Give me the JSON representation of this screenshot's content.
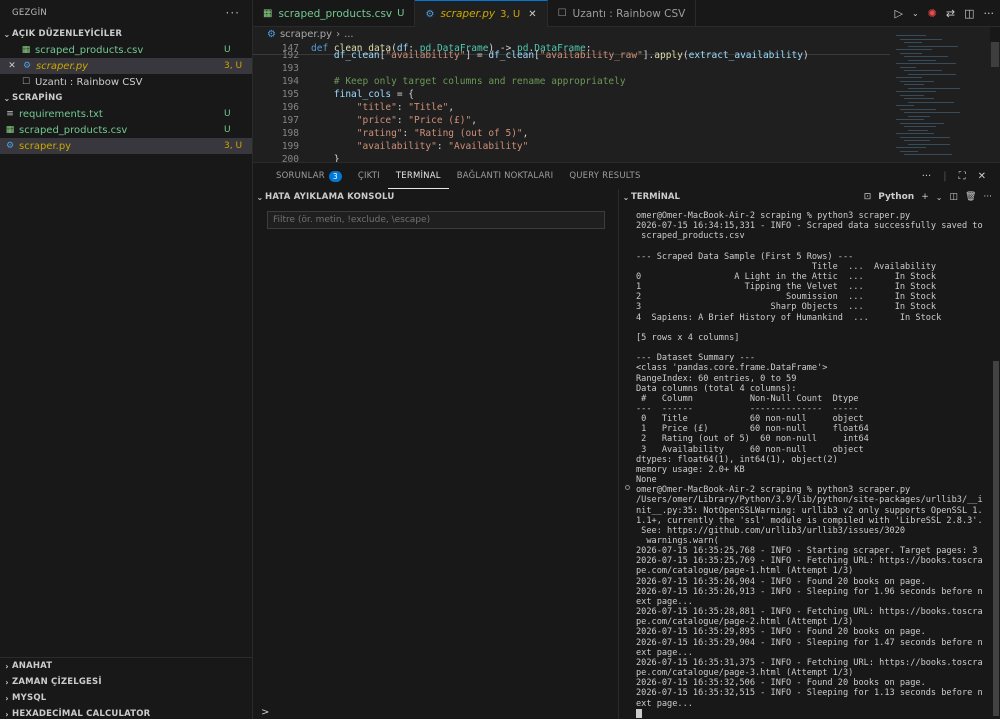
{
  "sidebar": {
    "title": "GEZGİN",
    "open_editors": {
      "label": "AÇIK DÜZENLEYİCİLER",
      "items": [
        {
          "name": "scraped_products.csv",
          "badge": "U"
        },
        {
          "name": "scraper.py",
          "badge": "3, U"
        },
        {
          "name": "Uzantı : Rainbow CSV",
          "badge": ""
        }
      ]
    },
    "folder": {
      "label": "SCRAPİNG",
      "items": [
        {
          "name": "requirements.txt",
          "badge": "U"
        },
        {
          "name": "scraped_products.csv",
          "badge": "U"
        },
        {
          "name": "scraper.py",
          "badge": "3, U"
        }
      ]
    },
    "bottom_sections": [
      "ANAHAT",
      "ZAMAN ÇİZELGESİ",
      "MYSQL",
      "HEXADECİMAL CALCULATOR"
    ]
  },
  "tabs": [
    {
      "label": "scraped_products.csv",
      "badge": "U"
    },
    {
      "label": "scraper.py",
      "badge": "3, U"
    },
    {
      "label": "Uzantı : Rainbow CSV",
      "badge": ""
    }
  ],
  "breadcrumb": {
    "file": "scraper.py",
    "rest": "..."
  },
  "editor": {
    "sticky_line": {
      "num": "147"
    },
    "lines": [
      {
        "num": "192"
      },
      {
        "num": "193"
      },
      {
        "num": "194"
      },
      {
        "num": "195"
      },
      {
        "num": "196"
      },
      {
        "num": "197"
      },
      {
        "num": "198"
      },
      {
        "num": "199"
      },
      {
        "num": "200"
      }
    ]
  },
  "panel": {
    "tabs": [
      {
        "label": "SORUNLAR",
        "badge": "3"
      },
      {
        "label": "ÇIKTI"
      },
      {
        "label": "TERMİNAL"
      },
      {
        "label": "BAĞLANTI NOKTALARI"
      },
      {
        "label": "QUERY RESULTS"
      }
    ],
    "debug": {
      "title": "HATA AYIKLAMA KONSOLU",
      "filter_placeholder": "Filtre (ör. metin, !exclude, \\escape)",
      "prompt": ">"
    },
    "terminal": {
      "title": "TERMİNAL",
      "shell": "Python",
      "lines": [
        "omer@Omer-MacBook-Air-2 scraping % python3 scraper.py",
        "2026-07-15 16:34:15,331 - INFO - Scraped data successfully saved to",
        " scraped_products.csv",
        "",
        "--- Scraped Data Sample (First 5 Rows) ---",
        "                                  Title  ...  Availability",
        "0                  A Light in the Attic  ...      In Stock",
        "1                    Tipping the Velvet  ...      In Stock",
        "2                            Soumission  ...      In Stock",
        "3                         Sharp Objects  ...      In Stock",
        "4  Sapiens: A Brief History of Humankind  ...      In Stock",
        "",
        "[5 rows x 4 columns]",
        "",
        "--- Dataset Summary ---",
        "<class 'pandas.core.frame.DataFrame'>",
        "RangeIndex: 60 entries, 0 to 59",
        "Data columns (total 4 columns):",
        " #   Column           Non-Null Count  Dtype",
        "---  ------           --------------  -----",
        " 0   Title            60 non-null     object",
        " 1   Price (£)        60 non-null     float64",
        " 2   Rating (out of 5)  60 non-null     int64",
        " 3   Availability     60 non-null     object",
        "dtypes: float64(1), int64(1), object(2)",
        "memory usage: 2.0+ KB",
        "None",
        "omer@Omer-MacBook-Air-2 scraping % python3 scraper.py",
        "/Users/omer/Library/Python/3.9/lib/python/site-packages/urllib3/__i",
        "nit__.py:35: NotOpenSSLWarning: urllib3 v2 only supports OpenSSL 1.",
        "1.1+, currently the 'ssl' module is compiled with 'LibreSSL 2.8.3'.",
        " See: https://github.com/urllib3/urllib3/issues/3020",
        "  warnings.warn(",
        "2026-07-15 16:35:25,768 - INFO - Starting scraper. Target pages: 3",
        "2026-07-15 16:35:25,769 - INFO - Fetching URL: https://books.toscra",
        "pe.com/catalogue/page-1.html (Attempt 1/3)",
        "2026-07-15 16:35:26,904 - INFO - Found 20 books on page.",
        "2026-07-15 16:35:26,913 - INFO - Sleeping for 1.96 seconds before n",
        "ext page...",
        "2026-07-15 16:35:28,881 - INFO - Fetching URL: https://books.toscra",
        "pe.com/catalogue/page-2.html (Attempt 1/3)",
        "2026-07-15 16:35:29,895 - INFO - Found 20 books on page.",
        "2026-07-15 16:35:29,904 - INFO - Sleeping for 1.47 seconds before n",
        "ext page...",
        "2026-07-15 16:35:31,375 - INFO - Fetching URL: https://books.toscra",
        "pe.com/catalogue/page-3.html (Attempt 1/3)",
        "2026-07-15 16:35:32,506 - INFO - Found 20 books on page.",
        "2026-07-15 16:35:32,515 - INFO - Sleeping for 1.13 seconds before n",
        "ext page..."
      ]
    }
  },
  "colors": {
    "accent": "#0078d4",
    "untracked": "#73c991",
    "modified": "#cca700"
  }
}
